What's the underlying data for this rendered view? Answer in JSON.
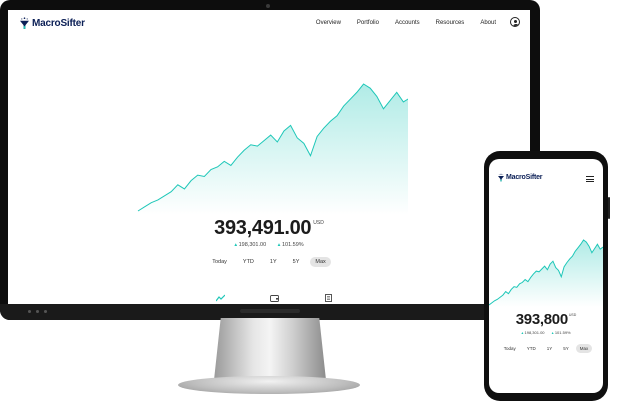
{
  "brand": {
    "name": "MacroSifter",
    "accent": "#1ec7b8",
    "navy": "#0b1f56"
  },
  "nav": {
    "items": [
      "Overview",
      "Portfolio",
      "Accounts",
      "Resources",
      "About"
    ]
  },
  "desktop": {
    "value": "393,491.00",
    "currency": "USD",
    "change_abs": "198,301.00",
    "change_pct": "101.59%",
    "ranges": [
      "Today",
      "YTD",
      "1Y",
      "5Y",
      "Max"
    ],
    "active_range": "Max",
    "bottom_nav_icons": [
      "chart-icon",
      "wallet-icon",
      "document-icon"
    ]
  },
  "mobile": {
    "value": "393,800",
    "currency": "USD",
    "change_abs": "198,301.00",
    "change_pct": "101.59%",
    "ranges": [
      "Today",
      "YTD",
      "1Y",
      "5Y",
      "Max"
    ],
    "active_range": "Max"
  },
  "chart_data": {
    "type": "area",
    "title": "",
    "xlabel": "",
    "ylabel": "",
    "grid": false,
    "series": [
      {
        "values": [
          8,
          11,
          14,
          16,
          19,
          22,
          27,
          24,
          30,
          34,
          33,
          38,
          40,
          44,
          41,
          47,
          52,
          56,
          55,
          59,
          63,
          58,
          66,
          70,
          61,
          57,
          48,
          62,
          68,
          73,
          77,
          84,
          89,
          94,
          100,
          97,
          91,
          82,
          88,
          94,
          87,
          90
        ]
      }
    ]
  }
}
